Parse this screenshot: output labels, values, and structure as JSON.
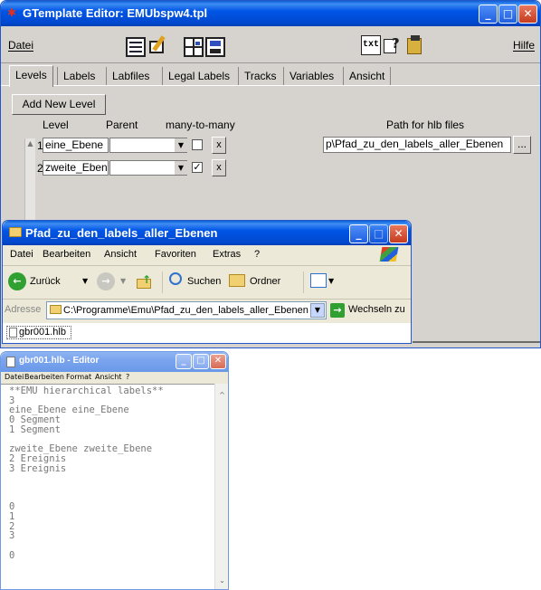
{
  "gtemplate": {
    "title": "GTemplate Editor: EMUbspw4.tpl",
    "menu_datei": "Datei",
    "menu_hilfe": "Hilfe",
    "toolbar_txt": "txt",
    "tabs": [
      "Levels",
      "Labels",
      "Labfiles",
      "Legal Labels",
      "Tracks",
      "Variables",
      "Ansicht"
    ],
    "add_new_level": "Add New Level",
    "col_level": "Level",
    "col_parent": "Parent",
    "col_many": "many-to-many",
    "col_path": "Path for hlb files",
    "rows": [
      {
        "num": "1",
        "name": "eine_Ebene",
        "parent": "",
        "many": "",
        "remove": "x"
      },
      {
        "num": "2",
        "name": "zweite_Eben",
        "parent": "",
        "many": "✓",
        "remove": "x"
      }
    ],
    "path_value": "p\\Pfad_zu_den_labels_aller_Ebenen",
    "browse": "..."
  },
  "explorer": {
    "title": "Pfad_zu_den_labels_aller_Ebenen",
    "menu": [
      "Datei",
      "Bearbeiten",
      "Ansicht",
      "Favoriten",
      "Extras",
      "?"
    ],
    "back": "Zurück",
    "search": "Suchen",
    "folders": "Ordner",
    "address_label": "Adresse",
    "address_value": "C:\\Programme\\Emu\\Pfad_zu_den_labels_aller_Ebenen",
    "go": "Wechseln zu",
    "file": "gbr001.hlb"
  },
  "editor": {
    "title": "gbr001.hlb - Editor",
    "menu": [
      "Datei",
      "Bearbeiten",
      "Format",
      "Ansicht",
      "?"
    ],
    "lines": [
      "**EMU hierarchical labels**",
      "3",
      "eine_Ebene eine_Ebene",
      "0 Segment",
      "1 Segment",
      "",
      "zweite_Ebene zweite_Ebene",
      "2 Ereignis",
      "3 Ereignis",
      "",
      "",
      "",
      "0",
      "1",
      "2",
      "3",
      "",
      "0"
    ]
  },
  "colors": {
    "xp_blue": "#0055e5",
    "dialog_gray": "#d6d3ce",
    "xp_beige": "#ece9d8",
    "close_red": "#c63b1e"
  }
}
